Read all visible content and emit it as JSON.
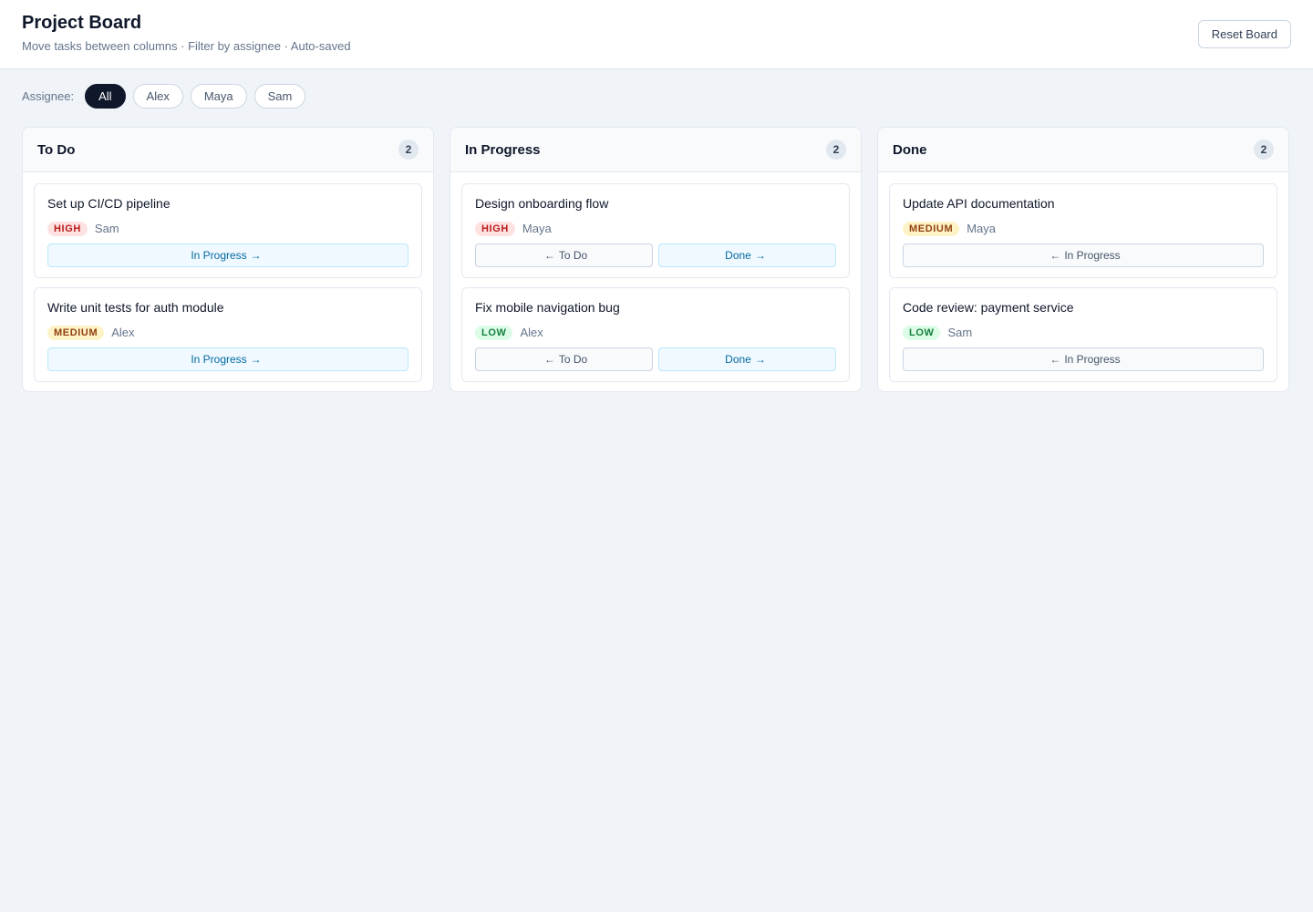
{
  "header": {
    "title": "Project Board",
    "subtitle": "Move tasks between columns · Filter by assignee · Auto-saved",
    "reset_label": "Reset Board"
  },
  "filter": {
    "label": "Assignee:",
    "chips": [
      "All",
      "Alex",
      "Maya",
      "Sam"
    ],
    "active": "All"
  },
  "columns": [
    {
      "title": "To Do",
      "count": "2",
      "cards": [
        {
          "title": "Set up CI/CD pipeline",
          "priority": "HIGH",
          "assignee": "Sam",
          "fwd_label": "In Progress"
        },
        {
          "title": "Write unit tests for auth module",
          "priority": "MEDIUM",
          "assignee": "Alex",
          "fwd_label": "In Progress"
        }
      ]
    },
    {
      "title": "In Progress",
      "count": "2",
      "cards": [
        {
          "title": "Design onboarding flow",
          "priority": "HIGH",
          "assignee": "Maya",
          "back_label": "To Do",
          "fwd_label": "Done"
        },
        {
          "title": "Fix mobile navigation bug",
          "priority": "LOW",
          "assignee": "Alex",
          "back_label": "To Do",
          "fwd_label": "Done"
        }
      ]
    },
    {
      "title": "Done",
      "count": "2",
      "cards": [
        {
          "title": "Update API documentation",
          "priority": "MEDIUM",
          "assignee": "Maya",
          "back_label": "In Progress"
        },
        {
          "title": "Code review: payment service",
          "priority": "LOW",
          "assignee": "Sam",
          "back_label": "In Progress"
        }
      ]
    }
  ],
  "icons": {
    "arrow_right": "arrow-right-icon",
    "arrow_left": "arrow-left-icon"
  },
  "colors": {
    "high": "#b91c1c",
    "medium": "#92400e",
    "low": "#15803d",
    "forward": "#0369a1",
    "active_chip": "#0f172a"
  }
}
